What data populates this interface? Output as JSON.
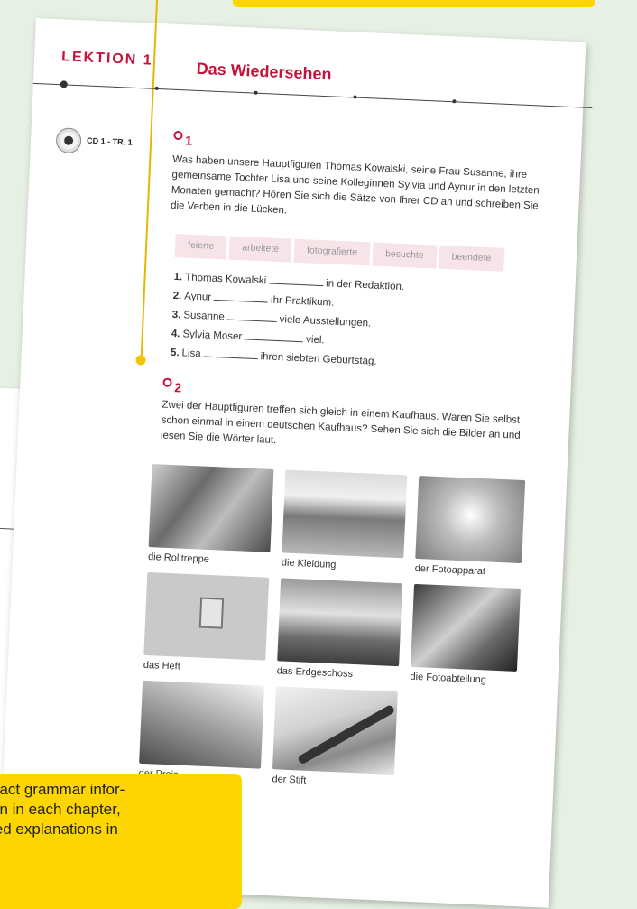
{
  "lesson": {
    "label": "LEKTION 1",
    "title": "Das Wiedersehen"
  },
  "cd": {
    "label": "CD 1 - TR. 1",
    "icon": "cd-icon"
  },
  "exercise1": {
    "number": "1",
    "instructions": "Was haben unsere Hauptfiguren Thomas Kowalski, seine Frau Susanne, ihre gemeinsame Tochter Lisa und seine Kolleginnen Sylvia und Aynur in den letzten Monaten gemacht? Hören Sie sich die Sätze von Ihrer CD an und schreiben Sie die Verben in die Lücken.",
    "words": [
      "feierte",
      "arbeitete",
      "fotografierte",
      "besuchte",
      "beendete"
    ],
    "sentences": [
      {
        "num": "1.",
        "before": "Thomas Kowalski",
        "after": "in der Redaktion."
      },
      {
        "num": "2.",
        "before": "Aynur",
        "after": "ihr Praktikum."
      },
      {
        "num": "3.",
        "before": "Susanne",
        "after": "viele Ausstellungen."
      },
      {
        "num": "4.",
        "before": "Sylvia Moser",
        "after": "viel."
      },
      {
        "num": "5.",
        "before": "Lisa",
        "after": "ihren siebten Geburtstag."
      }
    ]
  },
  "exercise2": {
    "number": "2",
    "instructions": "Zwei der Hauptfiguren treffen sich gleich in einem Kaufhaus. Waren Sie selbst schon einmal in einem deutschen Kaufhaus? Sehen Sie sich die Bilder an und lesen Sie die Wörter laut.",
    "pictures": [
      "die Rolltreppe",
      "die Kleidung",
      "der Fotoapparat",
      "das Heft",
      "das Erdgeschoss",
      "die Fotoabteilung",
      "der Preis",
      "der Stift"
    ]
  },
  "callout": {
    "lines": [
      "pact grammar infor-",
      "on in each chapter,",
      "led explanations in"
    ]
  }
}
